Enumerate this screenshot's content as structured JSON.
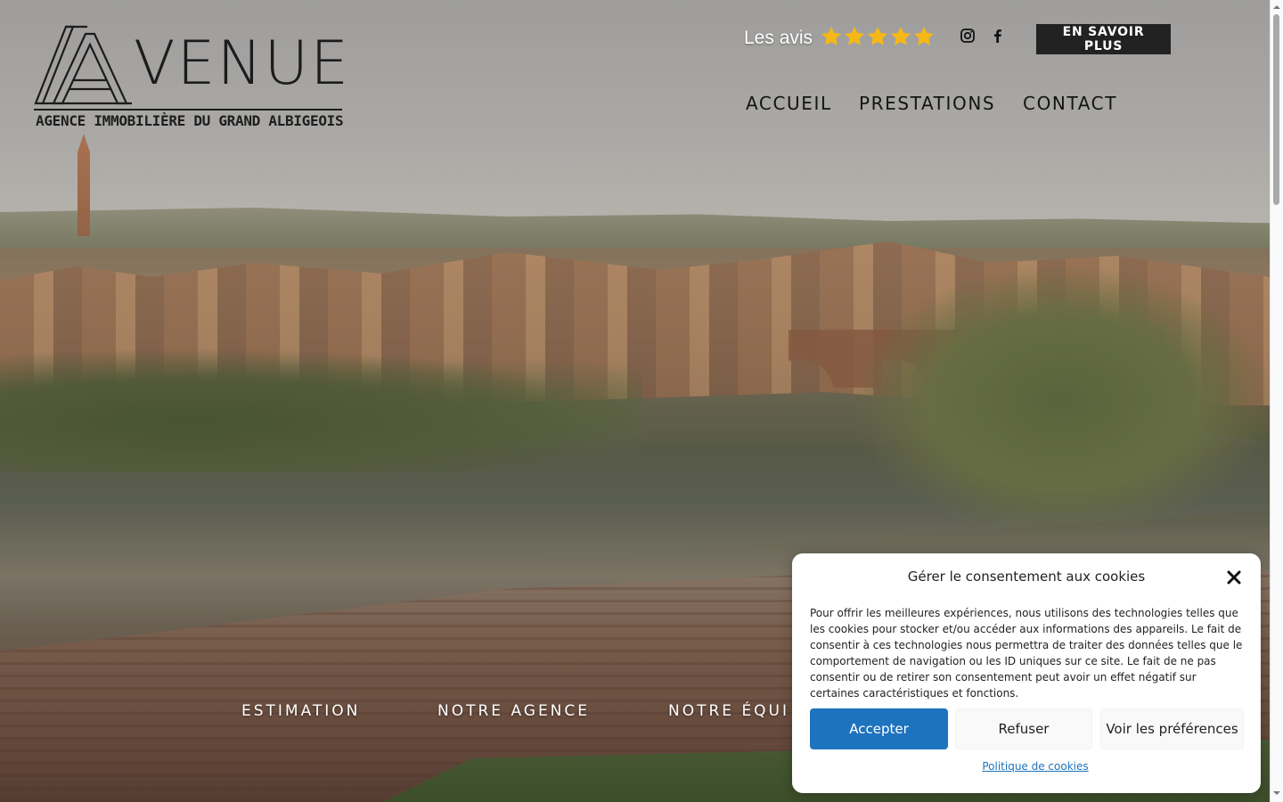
{
  "logo": {
    "wordmark": "VENUE",
    "tagline": "AGENCE IMMOBILIÈRE DU GRAND ALBIGEOIS"
  },
  "reviews": {
    "label": "Les avis",
    "stars": 5,
    "star_color": "#f5b817"
  },
  "social": {
    "instagram_icon": "instagram-icon",
    "facebook_icon": "facebook-icon"
  },
  "header": {
    "cta_label": "EN SAVOIR PLUS"
  },
  "nav": {
    "items": [
      "ACCUEIL",
      "PRESTATIONS",
      "CONTACT"
    ]
  },
  "hero": {
    "links": [
      "ESTIMATION",
      "NOTRE AGENCE",
      "NOTRE ÉQUI"
    ]
  },
  "cookie": {
    "title": "Gérer le consentement aux cookies",
    "text": "Pour offrir les meilleures expériences, nous utilisons des technologies telles que les cookies pour stocker et/ou accéder aux informations des appareils. Le fait de consentir à ces technologies nous permettra de traiter des données telles que le comportement de navigation ou les ID uniques sur ce site. Le fait de ne pas consentir ou de retirer son consentement peut avoir un effet négatif sur certaines caractéristiques et fonctions.",
    "accept_label": "Accepter",
    "refuse_label": "Refuser",
    "prefs_label": "Voir les préférences",
    "policy_label": "Politique de cookies",
    "accent_color": "#1e73be"
  }
}
